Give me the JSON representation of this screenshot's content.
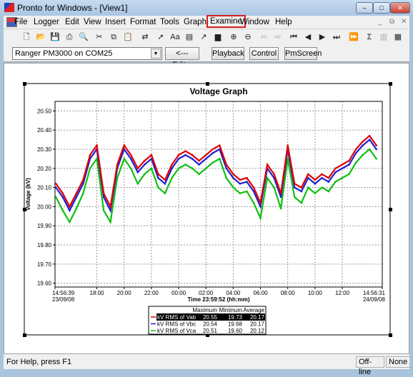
{
  "window": {
    "title": "Pronto for Windows - [View1]",
    "controls": [
      "minimize",
      "maximize",
      "close"
    ]
  },
  "menu": [
    {
      "label": "File"
    },
    {
      "label": "Logger"
    },
    {
      "label": "Edit"
    },
    {
      "label": "View"
    },
    {
      "label": "Insert"
    },
    {
      "label": "Format"
    },
    {
      "label": "Tools"
    },
    {
      "label": "Graph"
    },
    {
      "label": "Examine",
      "highlighted": true
    },
    {
      "label": "Window"
    },
    {
      "label": "Help"
    }
  ],
  "toolbar": [
    "new-icon",
    "open-icon",
    "save-icon",
    "print-icon",
    "print-preview-icon",
    "cut-icon",
    "copy-icon",
    "paste-icon",
    "import-icon",
    "pointer-icon",
    "text-icon",
    "list-icon",
    "arrow-icon",
    "graph-icon",
    "zoom-in-icon",
    "zoom-out-icon",
    "back-icon",
    "forward-icon",
    "first-icon",
    "previous-icon",
    "next-icon",
    "last-icon",
    "fast-forward-icon",
    "sum-icon",
    "chart-icon",
    "notes-icon",
    "help-icon",
    "context-help-icon"
  ],
  "toolbar2": {
    "logger_select": "Ranger PM3000 on COM25",
    "edit": "<--- Edit...",
    "playback": "Playback",
    "control": "Control",
    "pmscreen": "PmScreen"
  },
  "status": {
    "help": "For Help, press F1",
    "mode": "Off-line",
    "conn": "None"
  },
  "chart_data": {
    "type": "line",
    "title": "Voltage Graph",
    "ylabel": "Voltage (kV)",
    "xlabel": "Time 23:59:52 (hh:mm)",
    "ylim": [
      19.58,
      20.55
    ],
    "yticks": [
      "20.50",
      "20.40",
      "20.30",
      "20.20",
      "20.10",
      "20.00",
      "19.90",
      "19.80",
      "19.70",
      "19.60"
    ],
    "xticks": [
      {
        "label": "14:56:39",
        "sub": "23/09/08"
      },
      {
        "label": "18:00"
      },
      {
        "label": "20:00"
      },
      {
        "label": "22:00"
      },
      {
        "label": "00:00"
      },
      {
        "label": "02:00"
      },
      {
        "label": "04:00"
      },
      {
        "label": "06:00"
      },
      {
        "label": "08:00"
      },
      {
        "label": "10:00"
      },
      {
        "label": "12:00"
      },
      {
        "label": "14:56:31",
        "sub": "24/09/08"
      }
    ],
    "grid": true,
    "x": [
      "15:00",
      "15:30",
      "16:00",
      "16:30",
      "17:00",
      "17:30",
      "18:00",
      "18:30",
      "19:00",
      "19:30",
      "20:00",
      "20:30",
      "21:00",
      "21:30",
      "22:00",
      "22:30",
      "23:00",
      "23:30",
      "00:00",
      "00:30",
      "01:00",
      "01:30",
      "02:00",
      "02:30",
      "03:00",
      "03:30",
      "04:00",
      "04:30",
      "05:00",
      "05:30",
      "06:00",
      "06:30",
      "07:00",
      "07:30",
      "08:00",
      "08:30",
      "09:00",
      "09:30",
      "10:00",
      "10:30",
      "11:00",
      "11:30",
      "12:00",
      "12:30",
      "13:00",
      "13:30",
      "14:00",
      "14:30"
    ],
    "legend_headers": [
      "Maximum",
      "Minimum",
      "Average"
    ],
    "series": [
      {
        "name": "kV RMS of Vab",
        "color": "#e00000",
        "max": "20.55",
        "min": "19.73",
        "avg": "20.17",
        "selected": true,
        "values": [
          20.12,
          20.07,
          20.0,
          20.07,
          20.14,
          20.27,
          20.32,
          20.07,
          20.0,
          20.22,
          20.32,
          20.27,
          20.2,
          20.24,
          20.27,
          20.17,
          20.14,
          20.22,
          20.27,
          20.29,
          20.27,
          20.24,
          20.27,
          20.3,
          20.32,
          20.22,
          20.17,
          20.14,
          20.15,
          20.1,
          20.02,
          20.22,
          20.17,
          20.07,
          20.32,
          20.12,
          20.1,
          20.17,
          20.14,
          20.17,
          20.15,
          20.2,
          20.22,
          20.24,
          20.3,
          20.34,
          20.37,
          20.32
        ]
      },
      {
        "name": "kV RMS of Vbc",
        "color": "#2020d0",
        "max": "20.54",
        "min": "19.68",
        "avg": "20.17",
        "values": [
          20.1,
          20.05,
          19.98,
          20.05,
          20.12,
          20.25,
          20.3,
          20.05,
          19.98,
          20.2,
          20.3,
          20.25,
          20.18,
          20.22,
          20.25,
          20.15,
          20.12,
          20.2,
          20.25,
          20.27,
          20.25,
          20.22,
          20.25,
          20.28,
          20.3,
          20.2,
          20.15,
          20.12,
          20.13,
          20.08,
          20.0,
          20.2,
          20.15,
          20.05,
          20.3,
          20.1,
          20.08,
          20.15,
          20.12,
          20.15,
          20.13,
          20.18,
          20.2,
          20.22,
          20.28,
          20.32,
          20.35,
          20.3
        ]
      },
      {
        "name": "kV RMS of Vca",
        "color": "#10c010",
        "max": "20.51",
        "min": "19.60",
        "avg": "20.12",
        "values": [
          20.05,
          19.98,
          19.92,
          19.99,
          20.07,
          20.2,
          20.25,
          19.98,
          19.92,
          20.15,
          20.25,
          20.2,
          20.12,
          20.17,
          20.2,
          20.1,
          20.07,
          20.15,
          20.2,
          20.22,
          20.2,
          20.17,
          20.2,
          20.23,
          20.25,
          20.15,
          20.1,
          20.07,
          20.08,
          20.02,
          19.94,
          20.15,
          20.1,
          19.99,
          20.25,
          20.05,
          20.02,
          20.1,
          20.07,
          20.1,
          20.08,
          20.13,
          20.15,
          20.17,
          20.23,
          20.27,
          20.3,
          20.25
        ]
      }
    ]
  }
}
